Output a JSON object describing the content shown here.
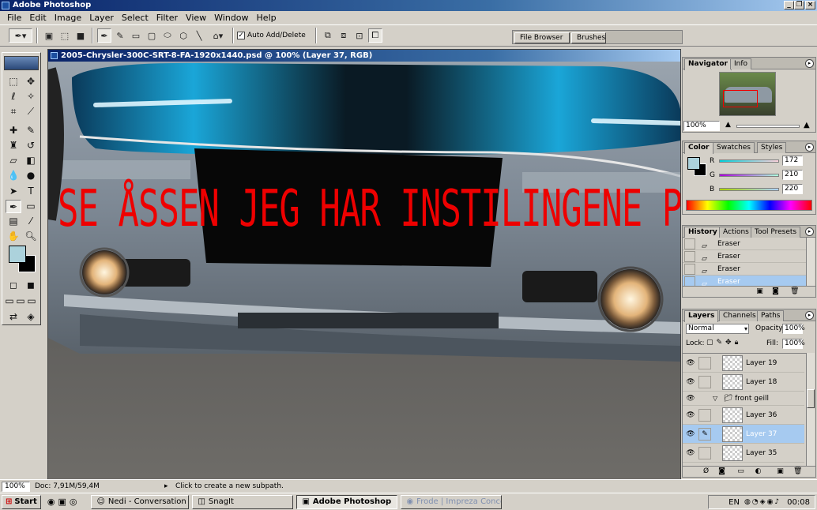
{
  "app": {
    "title": "Adobe Photoshop"
  },
  "menu": [
    "File",
    "Edit",
    "Image",
    "Layer",
    "Select",
    "Filter",
    "View",
    "Window",
    "Help"
  ],
  "options": {
    "auto_add_delete_label": "Auto Add/Delete",
    "auto_add_delete_checked": true
  },
  "palette_well": {
    "file_browser": "File Browser",
    "brushes": "Brushes"
  },
  "document": {
    "title": "2005-Chrysler-300C-SRT-8-FA-1920x1440.psd @ 100% (Layer 37, RGB)",
    "overlay_text": "SE ÅSSEN JEG HAR INSTILINGENE PÅ pen tool"
  },
  "status": {
    "zoom": "100%",
    "doc_size": "Doc: 7,91M/59,4M",
    "hint": "Click to create a new subpath."
  },
  "navigator": {
    "tabs": [
      "Navigator",
      "Info"
    ],
    "zoom": "100%"
  },
  "color": {
    "tabs": [
      "Color",
      "Swatches",
      "Styles"
    ],
    "r_label": "R",
    "g_label": "G",
    "b_label": "B",
    "r": "172",
    "g": "210",
    "b": "220",
    "fg_hex": "#acd2dc",
    "bg_hex": "#000000"
  },
  "history": {
    "tabs": [
      "History",
      "Actions",
      "Tool Presets"
    ],
    "items": [
      "Eraser",
      "Eraser",
      "Eraser",
      "Eraser"
    ],
    "selected_index": 3
  },
  "layers": {
    "tabs": [
      "Layers",
      "Channels",
      "Paths"
    ],
    "blend_mode": "Normal",
    "opacity_label": "Opacity:",
    "opacity": "100%",
    "lock_label": "Lock:",
    "fill_label": "Fill:",
    "fill": "100%",
    "rows": [
      {
        "name": "Layer 19",
        "type": "layer",
        "selected": false
      },
      {
        "name": "Layer 18",
        "type": "layer",
        "selected": false
      },
      {
        "name": "front geill",
        "type": "group",
        "selected": false
      },
      {
        "name": "Layer 36",
        "type": "layer",
        "selected": false
      },
      {
        "name": "Layer 37",
        "type": "layer",
        "selected": true
      },
      {
        "name": "Layer 35",
        "type": "layer",
        "selected": false
      }
    ]
  },
  "taskbar": {
    "start": "Start",
    "items": [
      "Nedi - Conversation",
      "SnagIt",
      "Adobe Photoshop",
      "Frode | Impreza Concept..."
    ],
    "active_index": 2,
    "lang": "EN",
    "clock": "00:08"
  },
  "icons": [
    "pen-icon",
    "magnifier-icon",
    "hand-icon",
    "eye-icon",
    "folder-icon",
    "trash-icon",
    "palette-menu-icon"
  ]
}
